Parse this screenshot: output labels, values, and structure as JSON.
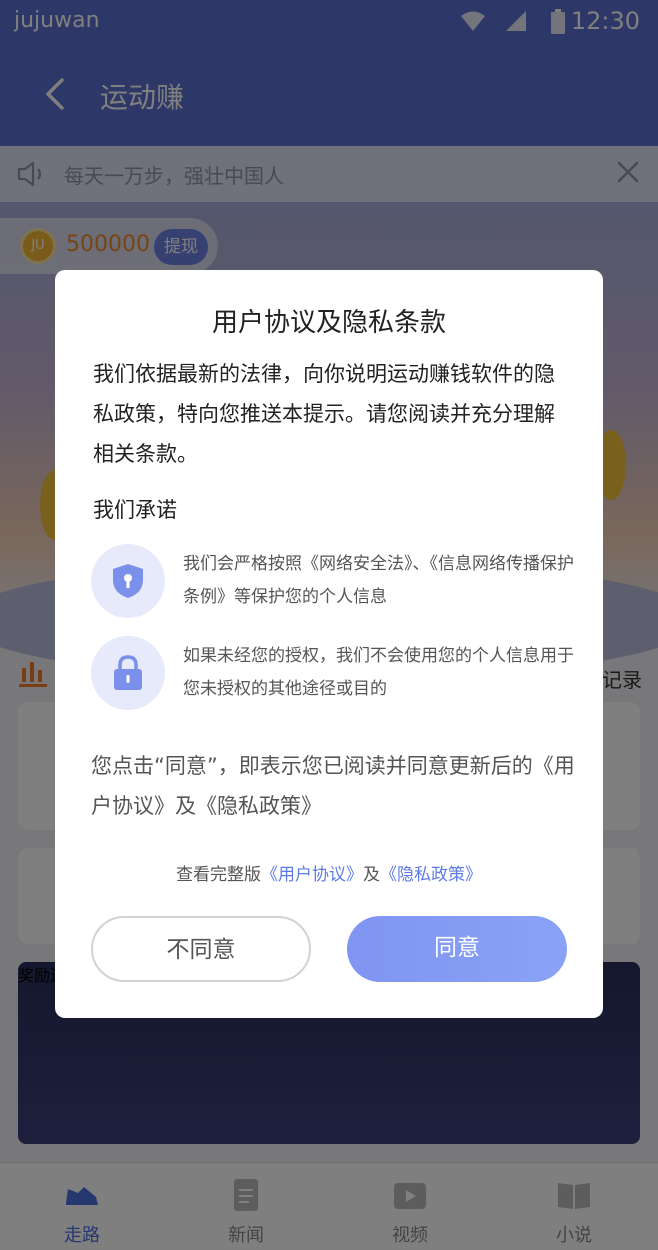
{
  "status": {
    "carrier": "jujuwan",
    "time": "12:30"
  },
  "navbar": {
    "title": "运动赚"
  },
  "notice": {
    "text": "每天一万步，强壮中国人"
  },
  "coin": {
    "badge": "JU",
    "value": "500000",
    "withdraw_label": "提现"
  },
  "records_label": "记录",
  "banner": {
    "text": "奖励送不停"
  },
  "tabs": [
    {
      "label": "走路",
      "icon": "shoe-icon",
      "active": true
    },
    {
      "label": "新闻",
      "icon": "news-icon",
      "active": false
    },
    {
      "label": "视频",
      "icon": "video-icon",
      "active": false
    },
    {
      "label": "小说",
      "icon": "book-icon",
      "active": false
    }
  ],
  "dialog": {
    "title": "用户协议及隐私条款",
    "intro": "我们依据最新的法律，向你说明运动赚钱软件的隐私政策，特向您推送本提示。请您阅读并充分理解相关条款。",
    "promise_heading": "我们承诺",
    "promises": [
      {
        "icon": "shield-icon",
        "text": "我们会严格按照《网络安全法》、《信息网络传播保护条例》等保护您的个人信息"
      },
      {
        "icon": "lock-icon",
        "text": "如果未经您的授权，我们不会使用您的个人信息用于您未授权的其他途径或目的"
      }
    ],
    "consent": "您点击“同意”，即表示您已阅读并同意更新后的《用户协议》及《隐私政策》",
    "full_prefix": "查看完整版",
    "user_agreement_link": "《用户协议》",
    "and": "及",
    "privacy_link": "《隐私政策》",
    "disagree_label": "不同意",
    "agree_label": "同意"
  },
  "colors": {
    "primary": "#5a6fd0",
    "accent": "#8aa2f6",
    "link": "#5d7be8",
    "coin": "#f08a24"
  }
}
